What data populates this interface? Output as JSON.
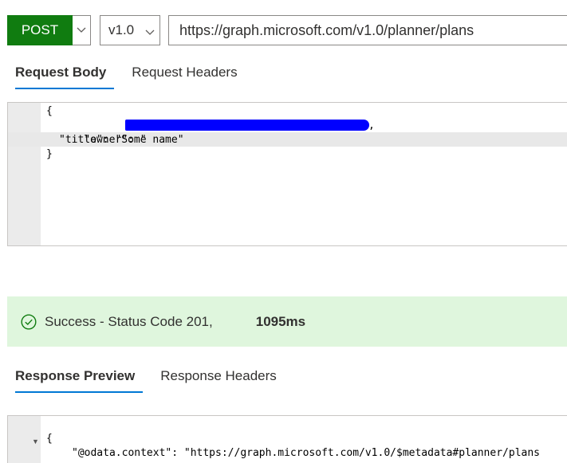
{
  "request": {
    "method": "POST",
    "version": "v1.0",
    "url": "https://graph.microsoft.com/v1.0/planner/plans"
  },
  "request_tabs": [
    "Request Body",
    "Request Headers"
  ],
  "request_body": {
    "line1": "{",
    "owner_key": "\"owner\": \"",
    "owner_tail": ",",
    "title_line": "\"title\": \"Some name\"",
    "line4": "}"
  },
  "status": {
    "message": "Success - Status Code 201,",
    "time": "1095ms",
    "color": "#dff6dd"
  },
  "response_tabs": [
    "Response Preview",
    "Response Headers"
  ],
  "response_body": {
    "line1": "{",
    "line2": "\"@odata.context\": \"https://graph.microsoft.com/v1.0/$metadata#planner/plans"
  },
  "colors": {
    "method": "#107c10",
    "tab_underline": "#0078d4",
    "redaction": "#0000ff"
  },
  "icons": [
    "chevron-down-icon",
    "check-circle-icon",
    "fold-arrow-icon"
  ]
}
